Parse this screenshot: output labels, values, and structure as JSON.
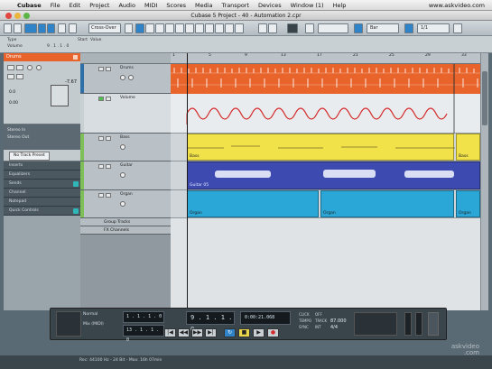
{
  "menubar": {
    "items": [
      "Cubase",
      "File",
      "Edit",
      "Project",
      "Audio",
      "MIDI",
      "Scores",
      "Media",
      "Transport",
      "Devices",
      "Window (1)",
      "Help"
    ],
    "url": "www.askvideo.com"
  },
  "window": {
    "title": "Cubase 5 Project - 40 - Automation 2.cpr"
  },
  "toolbar": {
    "mode_select": "Cross-Over",
    "snap_select": "Bar",
    "quantize_select": "1/1"
  },
  "infoline": {
    "type_label": "Type",
    "type_value": "Volume",
    "value": "9 . 1 . 1 . 0",
    "start_label": "Start",
    "value_label": "Value"
  },
  "inspector": {
    "track_name": "Drums",
    "volume_value": "-7.67",
    "pan_value": "0.0",
    "delay_value": "0.00",
    "routing_in": "Stereo In",
    "routing_out": "Stereo Out",
    "no_track_preset": "No Track Preset",
    "sections": [
      "Inserts",
      "Equalizers",
      "Sends",
      "Channel",
      "Notepad",
      "Quick Controls"
    ]
  },
  "tracks": [
    {
      "name": "Drums",
      "color": "#e8642b"
    },
    {
      "name": "Volume",
      "color": "#e8642b"
    },
    {
      "name": "Bass",
      "color": "#f2e24a"
    },
    {
      "name": "Guitar",
      "color": "#3d4bb0"
    },
    {
      "name": "Organ",
      "color": "#2aa7d6"
    }
  ],
  "folder_rows": [
    "Group Tracks",
    "FX Channels"
  ],
  "ruler": {
    "marks": [
      "1",
      "5",
      "9",
      "13",
      "17",
      "21",
      "25",
      "29",
      "33"
    ]
  },
  "events": {
    "bass_label": "Bass",
    "bass_label2": "Bass",
    "guitar_label": "Guitar 05",
    "organ_label": "Organ",
    "organ_label2": "Organ",
    "organ_label3": "Organ"
  },
  "transport": {
    "normal_label": "Normal",
    "mix_label": "Mix (MIDI)",
    "left_locator": "1 . 1 . 1 . 0",
    "right_locator": "13 . 1 . 1 . 0",
    "position": "9 . 1 . 1 . 0",
    "time": "0:00:21.068",
    "tempo": "87.000",
    "signature": "4/4",
    "click_label": "CLICK",
    "tempo_label": "TEMPO",
    "sync_label": "SYNC",
    "off_label": "OFF",
    "track_label": "TRACK",
    "int_label": "INT"
  },
  "status": {
    "text": "Rec: 44100 Hz - 24 Bit - Max: 16h 07min"
  },
  "watermark": {
    "line1": "askvideo",
    "line2": ".com"
  },
  "colors": {
    "drums": "#e8642b",
    "bass": "#f2e24a",
    "guitar": "#3d4bb0",
    "organ": "#2aa7d6",
    "automation_line": "#d42a2a"
  }
}
